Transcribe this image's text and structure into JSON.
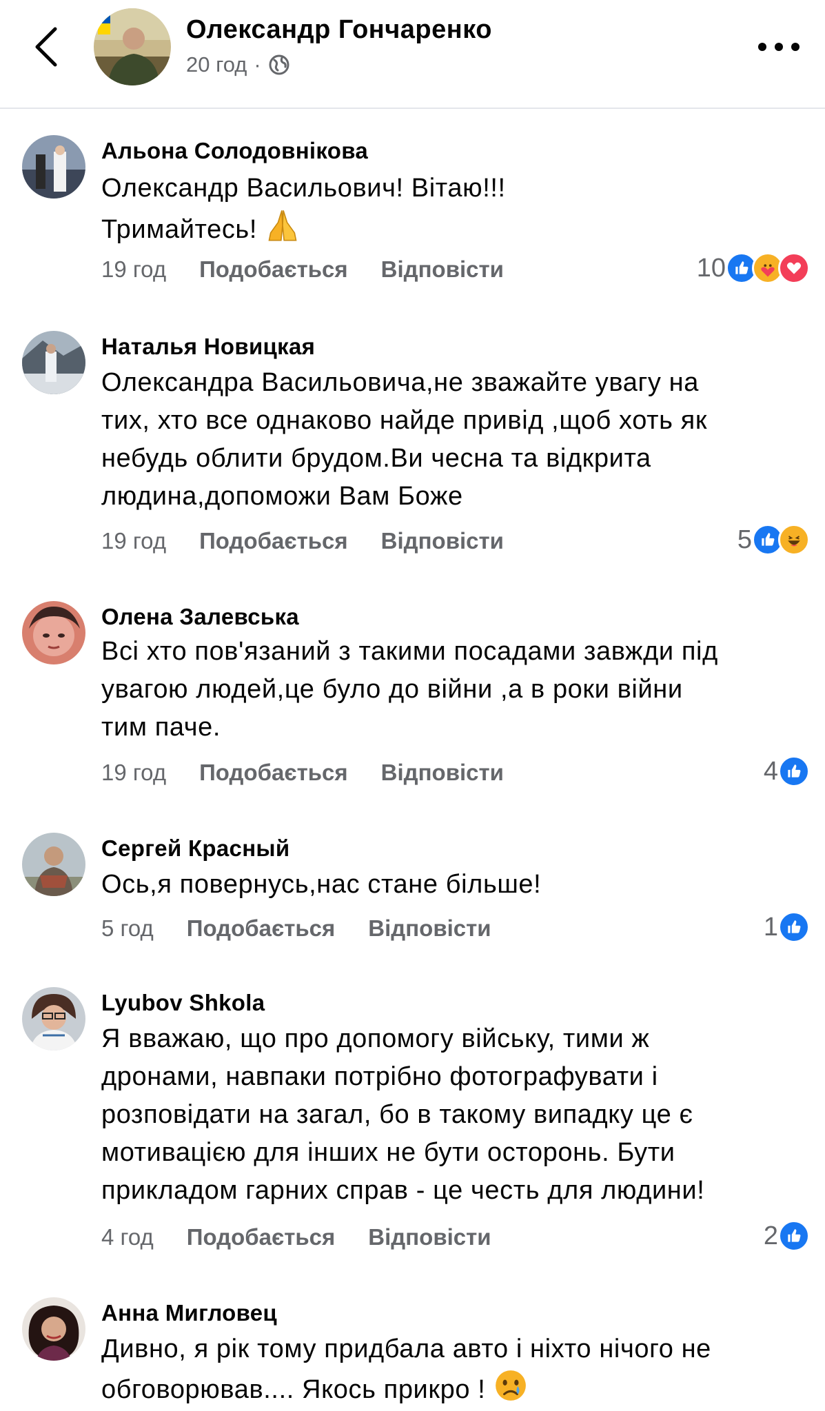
{
  "header": {
    "author": "Олександр Гончаренко",
    "time": "20 год",
    "separator": "·",
    "privacy_icon": "globe-icon",
    "back_icon": "chevron-left-icon",
    "more_icon": "more-dots-icon"
  },
  "labels": {
    "like": "Подобається",
    "reply": "Відповісти"
  },
  "comments": [
    {
      "name": "Альона Солодовнікова",
      "lines": [
        "Олександр Васильович! Вітаю!!!",
        "Тримайтесь!"
      ],
      "emoji": "folded-hands-emoji",
      "time": "19 год",
      "reaction_count": "10",
      "reactions": [
        "like",
        "care",
        "love"
      ]
    },
    {
      "name": "Наталья Новицкая",
      "lines": [
        "Олександра Васильовича,не зважайте увагу на",
        "тих, хто все однаково найде привід ,щоб хоть як",
        "небудь облити брудом.Ви чесна та відкрита",
        "людина,допоможи Вам Боже"
      ],
      "time": "19 год",
      "reaction_count": "5",
      "reactions": [
        "like",
        "haha"
      ]
    },
    {
      "name": "Олена Залевська",
      "lines": [
        "Всі хто пов'язаний з такими посадами завжди під",
        "увагою людей,це було до війни ,а в роки війни",
        "тим паче."
      ],
      "time": "19 год",
      "reaction_count": "4",
      "reactions": [
        "like"
      ]
    },
    {
      "name": "Сергей Красный",
      "lines": [
        "Ось,я повернусь,нас стане більше!"
      ],
      "time": "5 год",
      "reaction_count": "1",
      "reactions": [
        "like"
      ]
    },
    {
      "name": "Lyubov Shkola",
      "lines": [
        "Я вважаю, що про допомогу війську, тими ж",
        "дронами, навпаки потрібно фотографувати і",
        "розповідати на загал, бо в такому випадку це є",
        "мотивацією для інших не бути осторонь. Бути",
        "прикладом гарних справ - це честь для людини!"
      ],
      "time": "4 год",
      "reaction_count": "2",
      "reactions": [
        "like"
      ]
    },
    {
      "name": "Анна Мигловец",
      "lines": [
        "Дивно, я рік тому придбала авто і ніхто нічого не",
        "обговорював.... Якось прикро !"
      ],
      "emoji": "crying-face-emoji"
    }
  ],
  "colors": {
    "secondary_text": "#65676b",
    "like_blue": "#1877f2",
    "love_red": "#f33e58",
    "emoji_yellow": "#f7b125",
    "divider": "#e4e6eb"
  }
}
